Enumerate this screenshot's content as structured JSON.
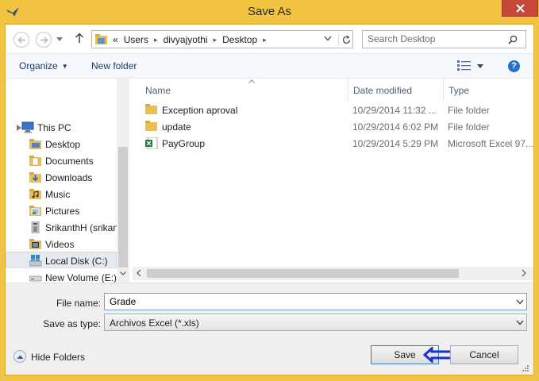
{
  "window": {
    "title": "Save As"
  },
  "address": {
    "crumbs": [
      "«",
      "Users",
      "divyajyothi",
      "Desktop"
    ],
    "search_placeholder": "Search Desktop"
  },
  "toolbar": {
    "organize_label": "Organize",
    "new_folder_label": "New folder",
    "help_label": "?"
  },
  "nav": {
    "items": [
      {
        "label": "This PC",
        "icon": "pc-icon"
      },
      {
        "label": "Desktop",
        "icon": "folder-icon"
      },
      {
        "label": "Documents",
        "icon": "documents-icon"
      },
      {
        "label": "Downloads",
        "icon": "downloads-icon"
      },
      {
        "label": "Music",
        "icon": "music-icon"
      },
      {
        "label": "Pictures",
        "icon": "pictures-icon"
      },
      {
        "label": "SrikanthH (srikan",
        "icon": "user-icon"
      },
      {
        "label": "Videos",
        "icon": "videos-icon"
      },
      {
        "label": "Local Disk (C:)",
        "icon": "drive-icon"
      },
      {
        "label": "New Volume (E:)",
        "icon": "drive-icon"
      }
    ],
    "selected": "Local Disk (C:)"
  },
  "columns": {
    "name": "Name",
    "date": "Date modified",
    "type": "Type"
  },
  "files": [
    {
      "name": "Exception aproval",
      "date": "10/29/2014 11:32 ...",
      "type": "File folder",
      "icon": "folder-icon"
    },
    {
      "name": "update",
      "date": "10/29/2014 6:02 PM",
      "type": "File folder",
      "icon": "folder-icon"
    },
    {
      "name": "PayGroup",
      "date": "10/29/2014 5:29 PM",
      "type": "Microsoft Excel 97...",
      "icon": "excel-file-icon"
    }
  ],
  "form": {
    "file_name_label": "File name:",
    "file_name_value": "Grade",
    "save_as_type_label": "Save as type:",
    "save_as_type_value": "Archivos Excel (*.xls)"
  },
  "footer": {
    "hide_folders_label": "Hide Folders",
    "save_label": "Save",
    "cancel_label": "Cancel"
  },
  "colors": {
    "titlebar": "#f2c341",
    "close": "#c7483a",
    "annotation_arrow": "#1a2fd6"
  }
}
